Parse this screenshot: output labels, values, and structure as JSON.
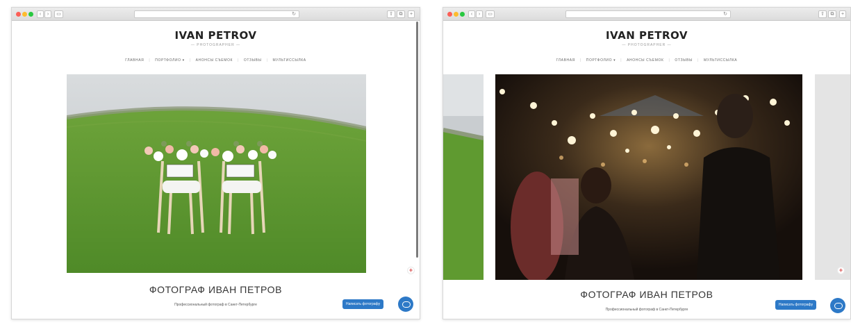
{
  "brand": {
    "name": "IVAN PETROV",
    "tagline": "— PHOTOGRAPHER —"
  },
  "nav": {
    "items": [
      "ГЛАВНАЯ",
      "ПОРТФОЛИО ▾",
      "АНОНСЫ СЪЕМОК",
      "ОТЗЫВЫ",
      "МУЛЬТИССЫЛКА"
    ]
  },
  "hero": {
    "title": "ФОТОГРАФ ИВАН ПЕТРОВ",
    "subtitle": "Профессиональный фотограф в Санкт-Петербурге"
  },
  "cta": {
    "label": "Написать фотографу"
  },
  "windows": [
    "left",
    "right"
  ],
  "colors": {
    "accent": "#2d79c7",
    "title": "#222222",
    "nav": "#666666",
    "traffic_red": "#fc5f57",
    "traffic_yellow": "#fdbc2e",
    "traffic_green": "#28c840"
  },
  "icons": [
    "back-icon",
    "forward-icon",
    "sidebar-icon",
    "reload-icon",
    "share-icon",
    "tabs-icon",
    "chat-icon",
    "plus-icon"
  ]
}
